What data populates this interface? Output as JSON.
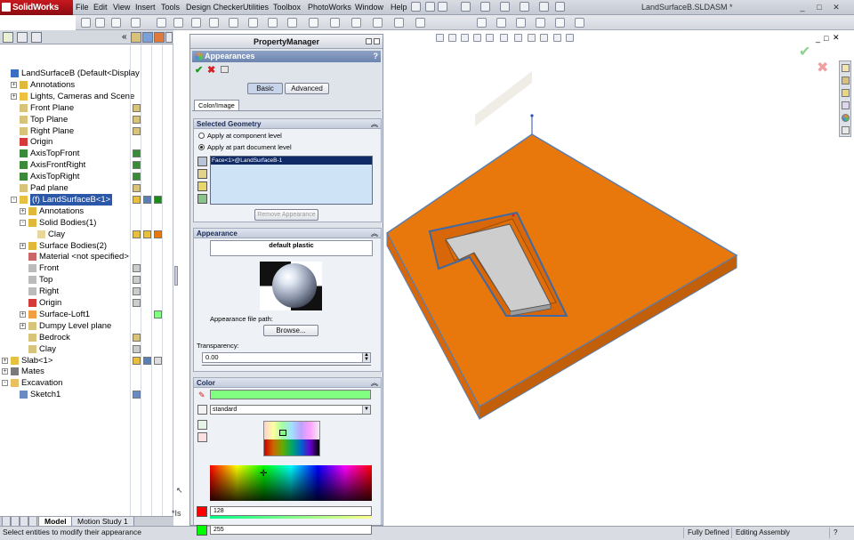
{
  "app": {
    "logo": "SolidWorks",
    "title": "LandSurfaceB.SLDASM *"
  },
  "menu": [
    "File",
    "Edit",
    "View",
    "Insert",
    "Tools",
    "Design Checker",
    "Utilities",
    "Toolbox",
    "PhotoWorks",
    "Window",
    "Help"
  ],
  "tree": [
    {
      "label": "LandSurfaceB  (Default<Display",
      "indent": 0,
      "expand": "",
      "icon": "assembly-icon"
    },
    {
      "label": "Annotations",
      "indent": 1,
      "expand": "+",
      "icon": "annotation-icon"
    },
    {
      "label": "Lights, Cameras and Scene",
      "indent": 1,
      "expand": "+",
      "icon": "lights-icon"
    },
    {
      "label": "Front Plane",
      "indent": 1,
      "expand": "",
      "icon": "plane-icon"
    },
    {
      "label": "Top Plane",
      "indent": 1,
      "expand": "",
      "icon": "plane-icon"
    },
    {
      "label": "Right Plane",
      "indent": 1,
      "expand": "",
      "icon": "plane-icon"
    },
    {
      "label": "Origin",
      "indent": 1,
      "expand": "",
      "icon": "origin-icon"
    },
    {
      "label": "AxisTopFront",
      "indent": 1,
      "expand": "",
      "icon": "axis-icon"
    },
    {
      "label": "AxisFrontRight",
      "indent": 1,
      "expand": "",
      "icon": "axis-icon"
    },
    {
      "label": "AxisTopRight",
      "indent": 1,
      "expand": "",
      "icon": "axis-icon"
    },
    {
      "label": "Pad plane",
      "indent": 1,
      "expand": "",
      "icon": "plane-icon"
    },
    {
      "label": "(f) LandSurfaceB<1>",
      "indent": 1,
      "expand": "-",
      "icon": "part-icon",
      "selected": true
    },
    {
      "label": "Annotations",
      "indent": 2,
      "expand": "+",
      "icon": "annotation-icon"
    },
    {
      "label": "Solid Bodies(1)",
      "indent": 2,
      "expand": "-",
      "icon": "solid-body-icon"
    },
    {
      "label": "Clay",
      "indent": 3,
      "expand": "",
      "icon": "body-icon"
    },
    {
      "label": "Surface Bodies(2)",
      "indent": 2,
      "expand": "+",
      "icon": "surface-body-icon"
    },
    {
      "label": "Material <not specified>",
      "indent": 2,
      "expand": "",
      "icon": "material-icon"
    },
    {
      "label": "Front",
      "indent": 2,
      "expand": "",
      "icon": "plane-outline-icon"
    },
    {
      "label": "Top",
      "indent": 2,
      "expand": "",
      "icon": "plane-outline-icon"
    },
    {
      "label": "Right",
      "indent": 2,
      "expand": "",
      "icon": "plane-outline-icon"
    },
    {
      "label": "Origin",
      "indent": 2,
      "expand": "",
      "icon": "origin-icon"
    },
    {
      "label": "Surface-Loft1",
      "indent": 2,
      "expand": "+",
      "icon": "loft-icon"
    },
    {
      "label": "Dumpy Level plane",
      "indent": 2,
      "expand": "+",
      "icon": "plane-icon"
    },
    {
      "label": "Bedrock",
      "indent": 2,
      "expand": "",
      "icon": "plane-icon"
    },
    {
      "label": "Clay",
      "indent": 2,
      "expand": "",
      "icon": "plane-icon"
    },
    {
      "label": "Slab<1>",
      "indent": 0,
      "expand": "+",
      "icon": "part-icon"
    },
    {
      "label": "Mates",
      "indent": 0,
      "expand": "+",
      "icon": "mates-icon"
    },
    {
      "label": "Excavation",
      "indent": 0,
      "expand": "-",
      "icon": "folder-icon"
    },
    {
      "label": "Sketch1",
      "indent": 1,
      "expand": "",
      "icon": "sketch-icon"
    }
  ],
  "bottom_tabs": [
    "Model",
    "Motion Study 1"
  ],
  "status": {
    "message": "Select entities to modify their appearance",
    "cells": [
      "Fully Defined",
      "Editing Assembly"
    ]
  },
  "pm": {
    "title": "PropertyManager",
    "header": "Appearances",
    "tabs": [
      "Basic",
      "Advanced"
    ],
    "subtab": "Color/Image",
    "selected_geometry": {
      "title": "Selected Geometry",
      "options": [
        "Apply at component level",
        "Apply at part document level"
      ],
      "item": "Face<1>@LandSurfaceB-1",
      "remove": "Remove Appearance"
    },
    "appearance": {
      "title": "Appearance",
      "name": "default plastic",
      "path_label": "Appearance file path:",
      "browse": "Browse...",
      "transparency_label": "Transparency:",
      "transparency_value": "0.00"
    },
    "color": {
      "title": "Color",
      "preset": "standard",
      "value1": "128",
      "value2": "255"
    }
  },
  "colors": {
    "orange": "#e8780c",
    "swatch_green": "#80ff80",
    "selection": "#2a57a8"
  }
}
